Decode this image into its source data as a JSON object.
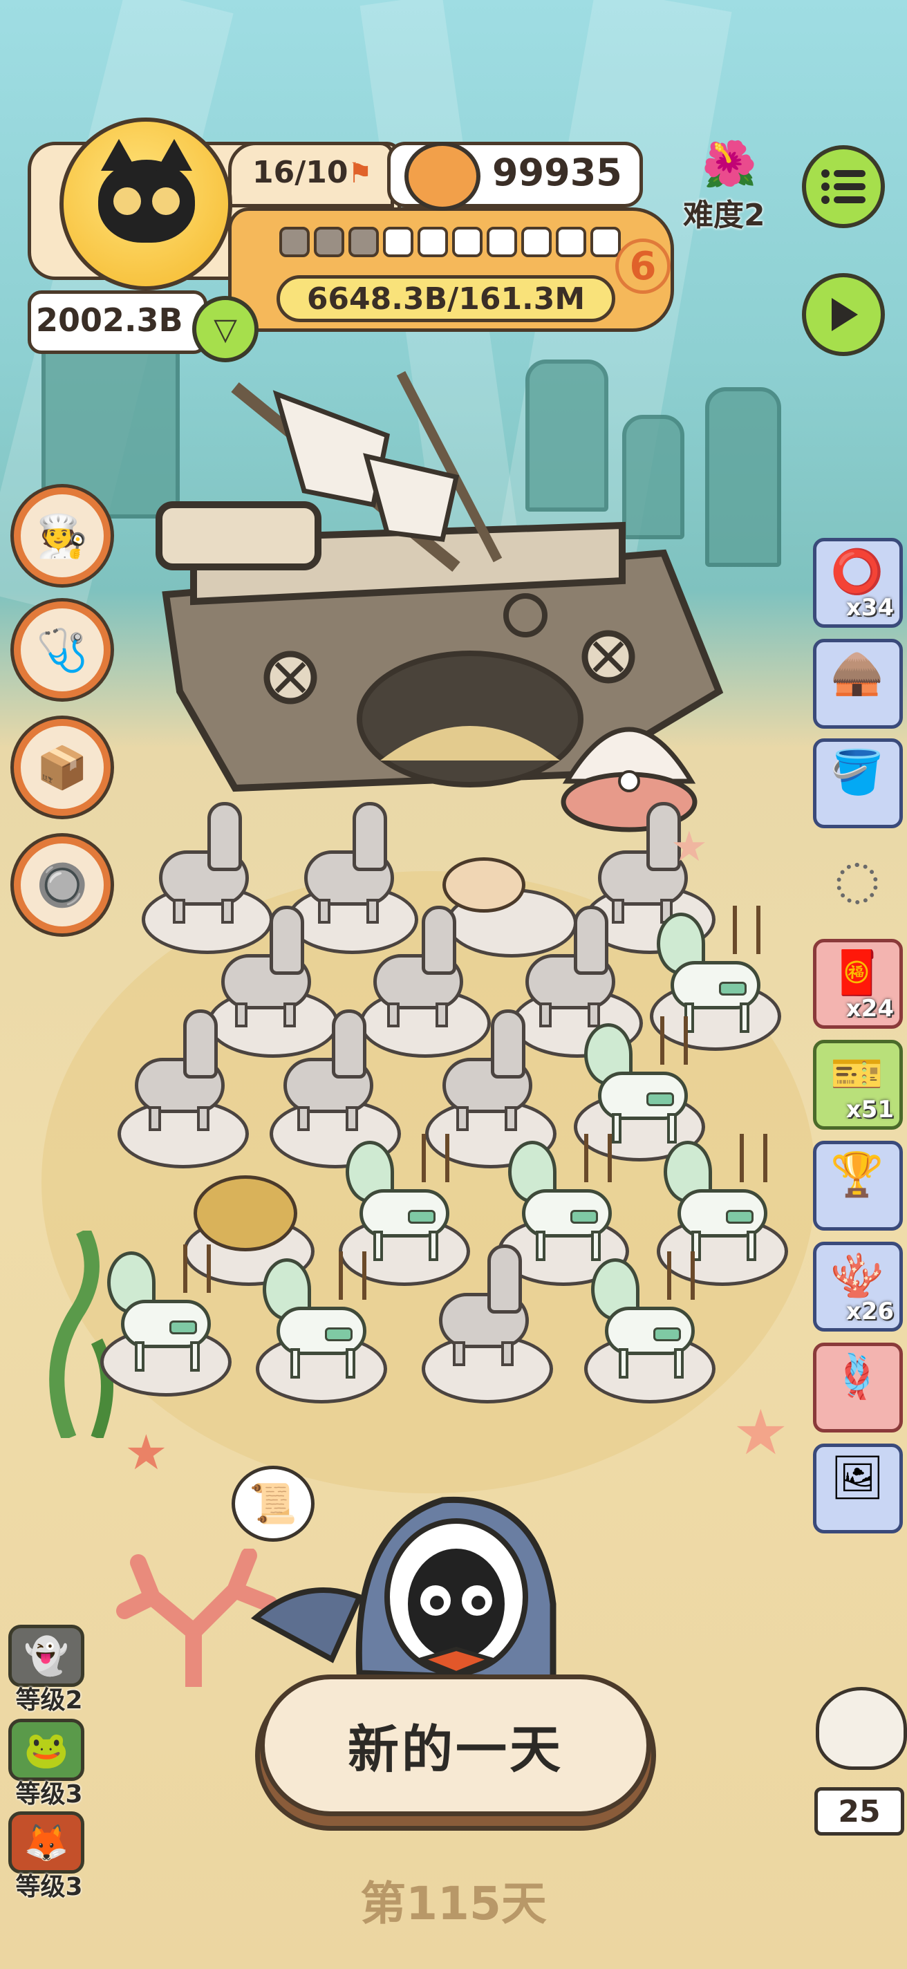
{
  "hud": {
    "population": "16/10",
    "coins": "99935",
    "difficulty": "难度2",
    "wealth": "2002.3B",
    "progress_text": "6648.3B/161.3M",
    "level": "6",
    "progress_segments_filled": 3,
    "progress_segments_total": 10
  },
  "side_items": [
    {
      "icon": "tire-icon",
      "count": "x34"
    },
    {
      "icon": "hut-icon",
      "count": ""
    },
    {
      "icon": "bucket-icon",
      "count": ""
    },
    {
      "icon": "scroll-icon",
      "count": "x24"
    },
    {
      "icon": "ticket-icon",
      "count": "x51"
    },
    {
      "icon": "trophy-icon",
      "count": ""
    },
    {
      "icon": "reef-icon",
      "count": "x26"
    },
    {
      "icon": "rope-icon",
      "count": ""
    },
    {
      "icon": "frame-icon",
      "count": ""
    }
  ],
  "left_menu": [
    {
      "icon": "staff-icon"
    },
    {
      "icon": "medkit-icon"
    },
    {
      "icon": "box-icon"
    },
    {
      "icon": "button-icon"
    }
  ],
  "levels": [
    {
      "label": "等级2"
    },
    {
      "label": "等级3"
    },
    {
      "label": "等级3"
    }
  ],
  "new_day_button": "新的一天",
  "day_counter": "第115天",
  "visitor_count": "25",
  "colors": {
    "accent_green": "#a6df4c",
    "panel_orange": "#f5b85a",
    "text_dark": "#3a2e26"
  }
}
